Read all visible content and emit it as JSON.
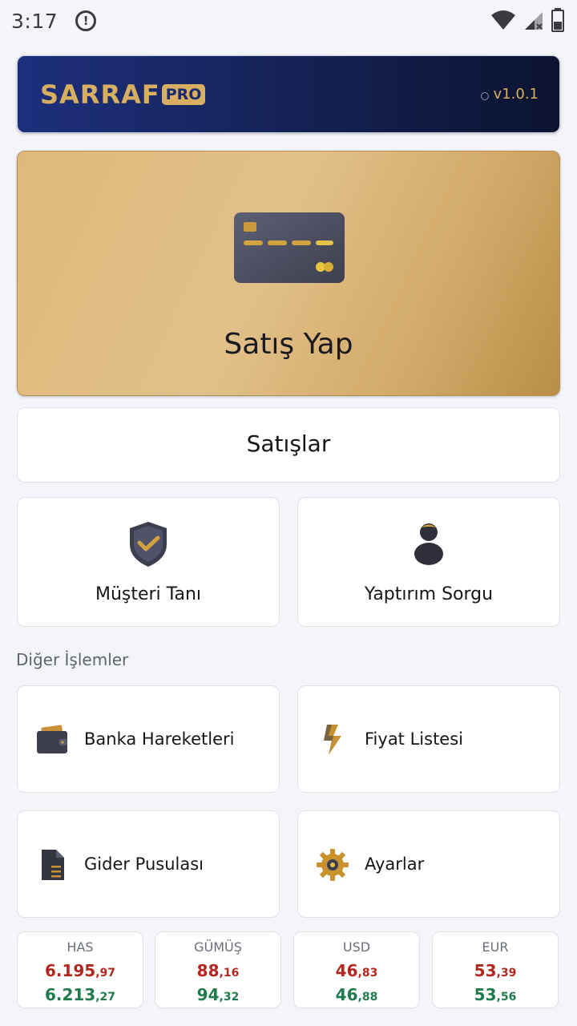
{
  "status": {
    "time": "3:17",
    "icons": [
      "alert-icon",
      "wifi-icon",
      "signal-icon",
      "battery-icon"
    ]
  },
  "header": {
    "logo_main": "SARRAF",
    "logo_badge": "PRO",
    "version": "v1.0.1",
    "colors": {
      "gold": "#d7ae62",
      "navy": "#1d2f7c"
    }
  },
  "sell": {
    "label": "Satış Yap",
    "icon": "credit-card-icon"
  },
  "sales": {
    "label": "Satışlar"
  },
  "tiles": [
    {
      "label": "Müşteri Tanı",
      "icon": "shield-check-icon"
    },
    {
      "label": "Yaptırım Sorgu",
      "icon": "person-icon"
    }
  ],
  "other": {
    "title": "Diğer İşlemler",
    "items": [
      {
        "label": "Banka Hareketleri",
        "icon": "wallet-icon"
      },
      {
        "label": "Fiyat Listesi",
        "icon": "lightning-icon"
      },
      {
        "label": "Gider Pusulası",
        "icon": "document-icon"
      },
      {
        "label": "Ayarlar",
        "icon": "gear-icon"
      }
    ]
  },
  "tickers": [
    {
      "name": "HAS",
      "sell_int": "6.195",
      "sell_dec": ",97",
      "buy_int": "6.213",
      "buy_dec": ",27"
    },
    {
      "name": "GÜMÜŞ",
      "sell_int": "88",
      "sell_dec": ",16",
      "buy_int": "94",
      "buy_dec": ",32"
    },
    {
      "name": "USD",
      "sell_int": "46",
      "sell_dec": ",83",
      "buy_int": "46",
      "buy_dec": ",88"
    },
    {
      "name": "EUR",
      "sell_int": "53",
      "sell_dec": ",39",
      "buy_int": "53",
      "buy_dec": ",56"
    }
  ]
}
